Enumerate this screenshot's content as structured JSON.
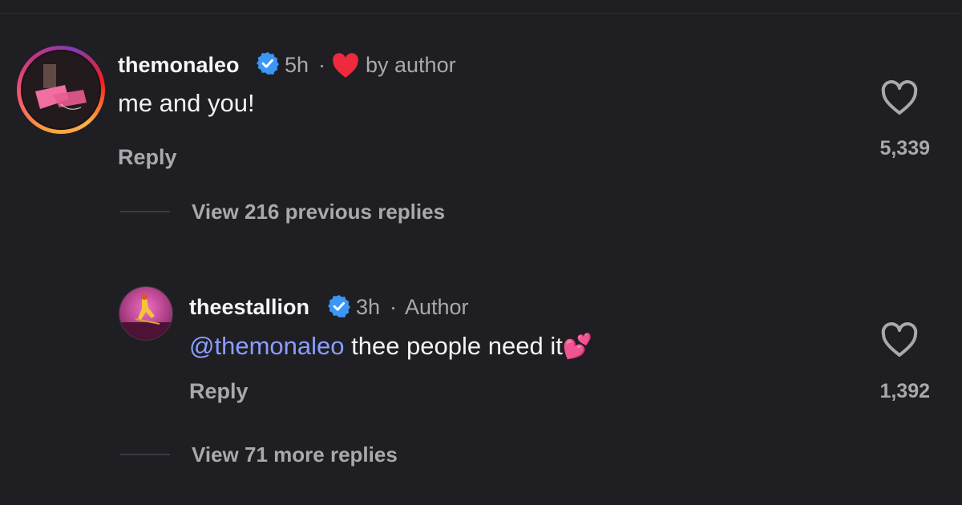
{
  "comment": {
    "username": "themonaleo",
    "time": "5h",
    "liked_by_author_label": "by author",
    "text": "me and you!",
    "reply_label": "Reply",
    "like_count": "5,339",
    "view_replies_label": "View 216 previous replies"
  },
  "reply": {
    "username": "theestallion",
    "time": "3h",
    "author_label": "Author",
    "mention": "@themonaleo",
    "text": "thee people need it",
    "emoji": "💕",
    "reply_label": "Reply",
    "like_count": "1,392",
    "view_replies_label": "View 71 more replies"
  },
  "colors": {
    "background": "#1f1f23",
    "secondary_text": "#a8a8ad",
    "mention": "#8b9dff",
    "verified": "#3b96f6",
    "author_heart": "#ed2a3e"
  },
  "icons": [
    "verified-badge-icon",
    "filled-heart-icon",
    "heart-outline-icon"
  ]
}
